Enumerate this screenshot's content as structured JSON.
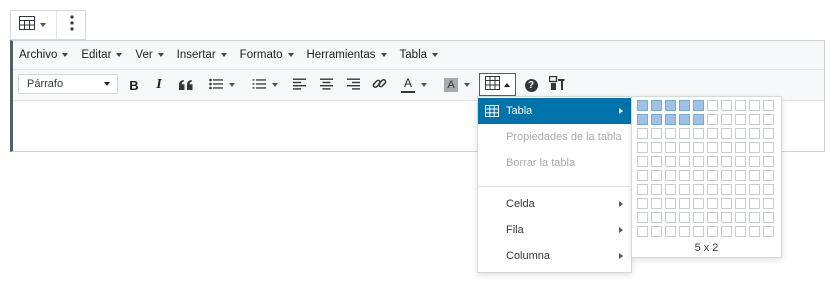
{
  "block_toolbar": {
    "table_icon": "table-block-icon",
    "more_icon": "vertical-ellipsis-icon"
  },
  "menubar": {
    "items": [
      "Archivo",
      "Editar",
      "Ver",
      "Insertar",
      "Formato",
      "Herramientas",
      "Tabla"
    ]
  },
  "toolbar": {
    "format_value": "Párrafo",
    "buttons": [
      "bold-icon",
      "italic-icon",
      "blockquote-icon",
      "bullet-list-icon",
      "numbered-list-icon",
      "align-left-icon",
      "align-center-icon",
      "align-right-icon",
      "link-icon",
      "text-color-icon",
      "background-color-icon",
      "table-icon",
      "help-icon",
      "toolbar-toggle-icon"
    ]
  },
  "table_menu": {
    "items": [
      {
        "label": "Tabla",
        "active": true,
        "submenu": true,
        "disabled": false
      },
      {
        "label": "Propiedades de la tabla",
        "active": false,
        "submenu": false,
        "disabled": true
      },
      {
        "label": "Borrar la tabla",
        "active": false,
        "submenu": false,
        "disabled": true
      },
      {
        "label": "Celda",
        "active": false,
        "submenu": true,
        "disabled": false
      },
      {
        "label": "Fila",
        "active": false,
        "submenu": true,
        "disabled": false
      },
      {
        "label": "Columna",
        "active": false,
        "submenu": true,
        "disabled": false
      }
    ]
  },
  "grid_picker": {
    "columns": 10,
    "rows": 10,
    "selected_cols": 5,
    "selected_rows": 2,
    "label": "5 x 2"
  },
  "colors": {
    "accent": "#0073aa",
    "selected_cell": "#9ec2e6"
  }
}
